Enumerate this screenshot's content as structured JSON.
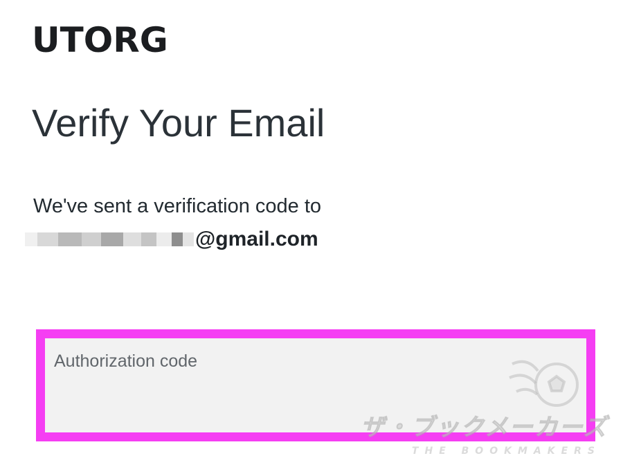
{
  "brand": {
    "logo_text": "UTORG"
  },
  "page": {
    "title": "Verify Your Email",
    "message": "We've sent a verification code to",
    "email_domain": "@gmail.com"
  },
  "form": {
    "authorization_label": "Authorization code",
    "authorization_value": ""
  },
  "watermark": {
    "main_text": "ザ・ブックメーカーズ",
    "sub_text": "THE BOOKMAKERS"
  },
  "colors": {
    "highlight_border": "#f53ef3",
    "field_background": "#f2f2f2",
    "text": "#222a30"
  }
}
